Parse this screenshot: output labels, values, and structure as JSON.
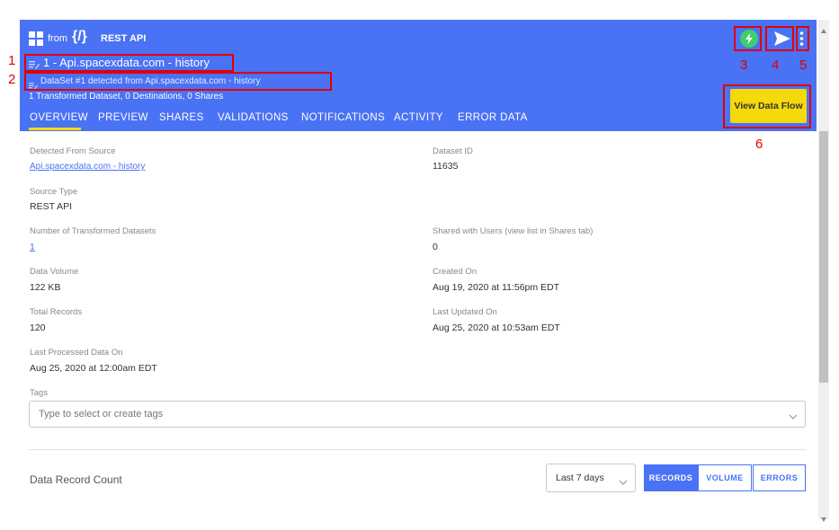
{
  "header": {
    "source_label": "from",
    "source_glyph": "{/}",
    "source_type": "REST API",
    "title": "1 - Api.spacexdata.com - history",
    "subtitle": "DataSet #1 detected from Api.spacexdata.com - history",
    "summary": "1 Transformed Dataset, 0 Destinations, 0 Shares",
    "view_flow_label": "View Data Flow"
  },
  "tabs": [
    {
      "label": "OVERVIEW"
    },
    {
      "label": "PREVIEW"
    },
    {
      "label": "SHARES"
    },
    {
      "label": "VALIDATIONS"
    },
    {
      "label": "NOTIFICATIONS"
    },
    {
      "label": "ACTIVITY"
    },
    {
      "label": "ERROR DATA"
    }
  ],
  "overview": {
    "detected_from_label": "Detected From Source",
    "detected_from_value": "Api.spacexdata.com - history",
    "dataset_id_label": "Dataset ID",
    "dataset_id_value": "11635",
    "source_type_label": "Source Type",
    "source_type_value": "REST API",
    "num_transformed_label": "Number of Transformed Datasets",
    "num_transformed_value": "1",
    "shared_users_label": "Shared with Users (view list in Shares tab)",
    "shared_users_value": "0",
    "data_volume_label": "Data Volume",
    "data_volume_value": "122 KB",
    "created_on_label": "Created On",
    "created_on_value": "Aug 19, 2020 at 11:56pm EDT",
    "total_records_label": "Total Records",
    "total_records_value": "120",
    "last_updated_label": "Last Updated On",
    "last_updated_value": "Aug 25, 2020 at 10:53am EDT",
    "last_processed_label": "Last Processed Data On",
    "last_processed_value": "Aug 25, 2020 at 12:00am EDT",
    "tags_label": "Tags",
    "tags_placeholder": "Type to select or create tags"
  },
  "record_count": {
    "title": "Data Record Count",
    "range_value": "Last 7 days",
    "buttons": [
      "RECORDS",
      "VOLUME",
      "ERRORS"
    ]
  },
  "annotations": [
    "1",
    "2",
    "3",
    "4",
    "5",
    "6"
  ],
  "colors": {
    "header_bg": "#4a72f5",
    "accent_yellow": "#f5d90a",
    "status_green": "#3fcf6f",
    "annotation_red": "#e00000"
  }
}
